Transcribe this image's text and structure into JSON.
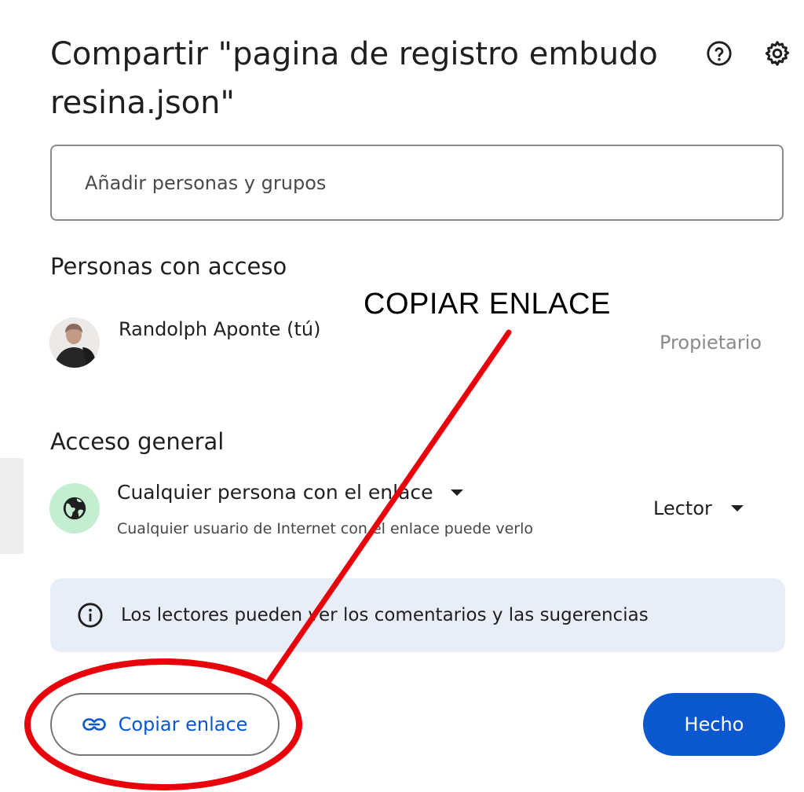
{
  "dialog": {
    "title": "Compartir \"pagina de registro embudo resina.json\"",
    "help_icon": "help-circle-icon",
    "settings_icon": "gear-icon"
  },
  "add_people": {
    "placeholder": "Añadir personas y grupos",
    "value": ""
  },
  "people_with_access": {
    "heading": "Personas con acceso",
    "people": [
      {
        "name": "Randolph Aponte (tú)",
        "role": "Propietario",
        "avatar": "user-photo"
      }
    ]
  },
  "general_access": {
    "heading": "Acceso general",
    "icon": "globe-icon",
    "scope": "Cualquier persona con el enlace",
    "description": "Cualquier usuario de Internet con el enlace puede verlo",
    "role": "Lector"
  },
  "info_banner": {
    "icon": "info-icon",
    "text": "Los lectores pueden ver los comentarios y las sugerencias"
  },
  "footer": {
    "copy_link_label": "Copiar enlace",
    "copy_link_icon": "link-icon",
    "done_label": "Hecho"
  },
  "annotation": {
    "text": "COPIAR ENLACE",
    "color": "#e8000b"
  },
  "colors": {
    "primary": "#0b57d0",
    "banner_bg": "#e8eef7",
    "globe_bg": "#c4eed0"
  }
}
